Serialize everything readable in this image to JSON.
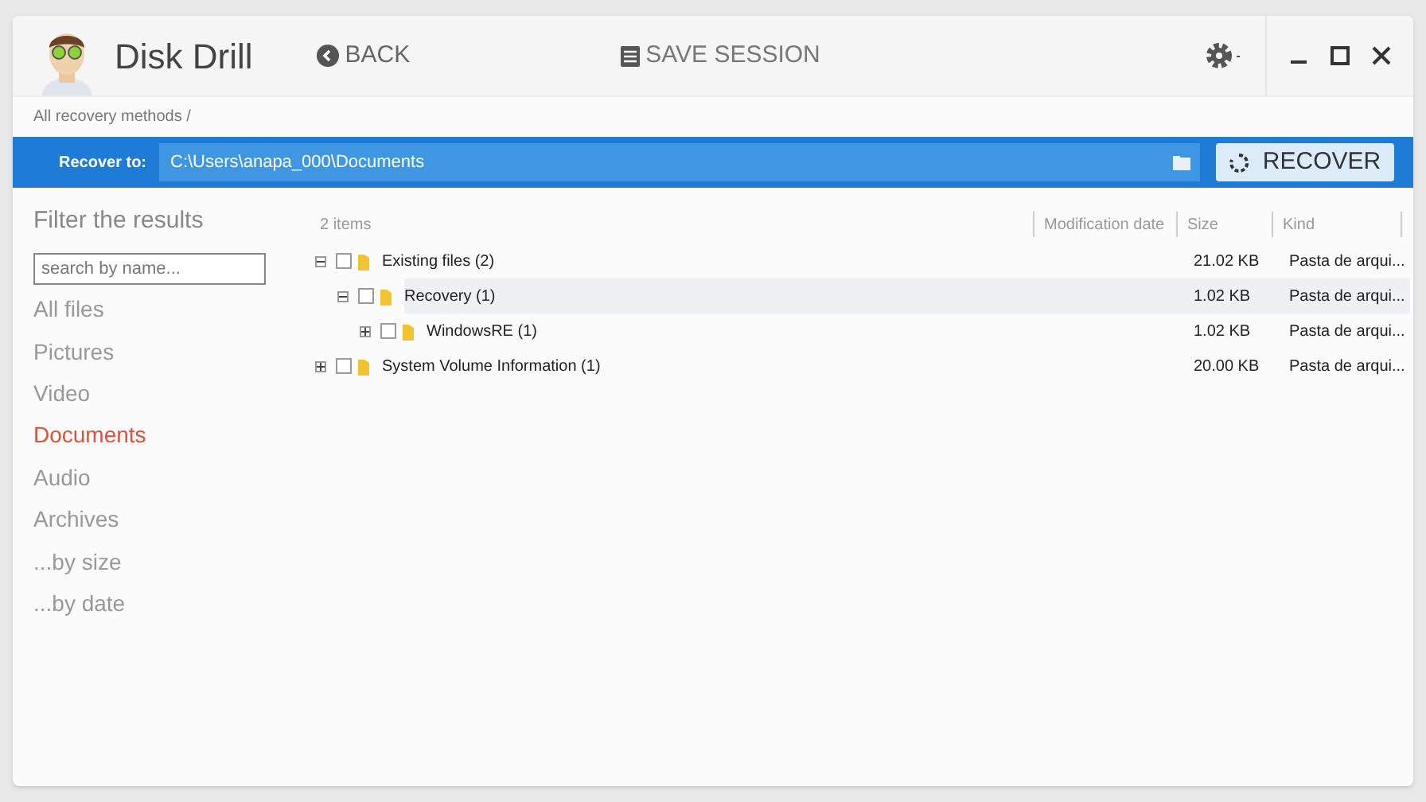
{
  "app": {
    "title": "Disk Drill"
  },
  "toolbar": {
    "back": "BACK",
    "save_session": "SAVE SESSION"
  },
  "breadcrumb": "All recovery methods /",
  "recover_bar": {
    "label": "Recover to:",
    "path": "C:\\Users\\anapa_000\\Documents",
    "button": "RECOVER"
  },
  "sidebar": {
    "title": "Filter the results",
    "search": {
      "placeholder": "search by name..."
    },
    "items": [
      {
        "label": "All files",
        "selected": false
      },
      {
        "label": "Pictures",
        "selected": false
      },
      {
        "label": "Video",
        "selected": false
      },
      {
        "label": "Documents",
        "selected": true
      },
      {
        "label": "Audio",
        "selected": false
      },
      {
        "label": "Archives",
        "selected": false
      },
      {
        "label": "...by size",
        "selected": false
      },
      {
        "label": "...by date",
        "selected": false
      }
    ]
  },
  "table": {
    "count": "2 items",
    "columns": [
      "Modification date",
      "Size",
      "Kind"
    ],
    "rows": [
      {
        "name": "Existing files (2)",
        "size": "21.02 KB",
        "kind": "Pasta de arqui...",
        "expanded": true,
        "checked": false,
        "selected": false,
        "children": [
          {
            "name": "Recovery (1)",
            "size": "1.02 KB",
            "kind": "Pasta de arqui...",
            "expanded": true,
            "checked": false,
            "selected": true,
            "children": [
              {
                "name": "WindowsRE (1)",
                "size": "1.02 KB",
                "kind": "Pasta de arqui...",
                "expanded": false,
                "checked": false,
                "selected": false
              }
            ]
          }
        ]
      },
      {
        "name": "System Volume Information (1)",
        "size": "20.00 KB",
        "kind": "Pasta de arqui...",
        "expanded": false,
        "checked": false,
        "selected": false
      }
    ]
  }
}
